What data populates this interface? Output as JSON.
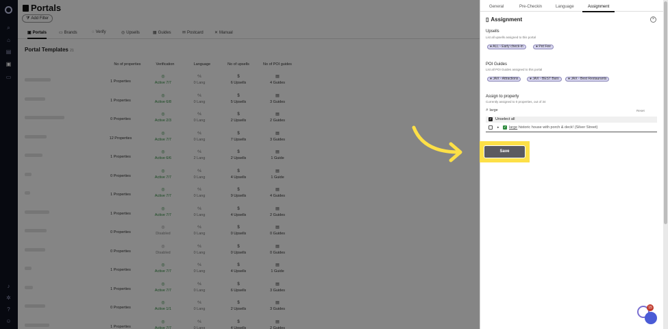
{
  "page": {
    "title": "Portals",
    "add_filter": "Add Filter"
  },
  "tabs": [
    "Portals",
    "Brands",
    "Verify",
    "Upsells",
    "Guides",
    "Postcard",
    "Manual"
  ],
  "section": {
    "title": "Portal Templates",
    "count": "21"
  },
  "columns": {
    "properties": "No of properties",
    "verification": "Verification",
    "language": "Language",
    "upsells": "No of upsells",
    "guides": "No of POI guides"
  },
  "rows": [
    {
      "props": "1 Properties",
      "ver": "Active 7/7",
      "lang": "0 Lang",
      "ups": "6 Upsells",
      "gui": "4 Guides",
      "on": true
    },
    {
      "props": "1 Properties",
      "ver": "Active 6/8",
      "lang": "0 Lang",
      "ups": "5 Upsells",
      "gui": "3 Guides",
      "on": true
    },
    {
      "props": "0 Properties",
      "ver": "Active 2/3",
      "lang": "0 Lang",
      "ups": "2 Upsells",
      "gui": "2 Guides",
      "on": true
    },
    {
      "props": "12 Properties",
      "ver": "Active 7/7",
      "lang": "0 Lang",
      "ups": "7 Upsells",
      "gui": "3 Guides",
      "on": true
    },
    {
      "props": "1 Properties",
      "ver": "Active 6/6",
      "lang": "2 Lang",
      "ups": "2 Upsells",
      "gui": "1 Guide",
      "on": true
    },
    {
      "props": "0 Properties",
      "ver": "Active 7/7",
      "lang": "0 Lang",
      "ups": "4 Upsells",
      "gui": "1 Guide",
      "on": true
    },
    {
      "props": "1 Properties",
      "ver": "Active 7/7",
      "lang": "0 Lang",
      "ups": "9 Upsells",
      "gui": "4 Guides",
      "on": true
    },
    {
      "props": "1 Properties",
      "ver": "Active 7/7",
      "lang": "0 Lang",
      "ups": "4 Upsells",
      "gui": "2 Guides",
      "on": true
    },
    {
      "props": "0 Properties",
      "ver": "Disabled",
      "lang": "0 Lang",
      "ups": "0 Upsells",
      "gui": "0 Guides",
      "on": false
    },
    {
      "props": "0 Properties",
      "ver": "Disabled",
      "lang": "0 Lang",
      "ups": "0 Upsells",
      "gui": "0 Guides",
      "on": false
    },
    {
      "props": "1 Properties",
      "ver": "Active 7/7",
      "lang": "0 Lang",
      "ups": "4 Upsells",
      "gui": "1 Guide",
      "on": true
    },
    {
      "props": "1 Properties",
      "ver": "Active 7/7",
      "lang": "0 Lang",
      "ups": "6 Upsells",
      "gui": "3 Guides",
      "on": true
    },
    {
      "props": "0 Properties",
      "ver": "Active 1/1",
      "lang": "0 Lang",
      "ups": "2 Upsells",
      "gui": "3 Guides",
      "on": true
    },
    {
      "props": "1 Properties",
      "ver": "Active 7/7",
      "lang": "0 Lang",
      "ups": "4 Upsells",
      "gui": "2 Guides",
      "on": true
    }
  ],
  "panel": {
    "tabs": [
      "General",
      "Pre-Checkin",
      "Language",
      "Assignment"
    ],
    "active_tab": "Assignment",
    "heading": "Assignment",
    "upsells_label": "Upsells",
    "upsells_sub": "List all upsells assigned to this portal",
    "upsell_chips": [
      "ALL - Early check-in",
      "Pet Fee"
    ],
    "guides_label": "POI Guides",
    "guides_sub": "List all POI Guides assigned to this portal",
    "guide_chips": [
      "JAX - Attractions",
      "JAX - BEST Bars",
      "JAX - Best Restaurants"
    ],
    "assign_label": "Assign to property",
    "assign_sub": "Currently assigned to 0 properties, out of 34",
    "search_value": "large",
    "reset": "Reset",
    "unselect": "Unselect all",
    "property_match": "large",
    "property_rest": " historic house with porch & deck! (Silver Street)",
    "save": "Save"
  },
  "chat_badge": "15"
}
